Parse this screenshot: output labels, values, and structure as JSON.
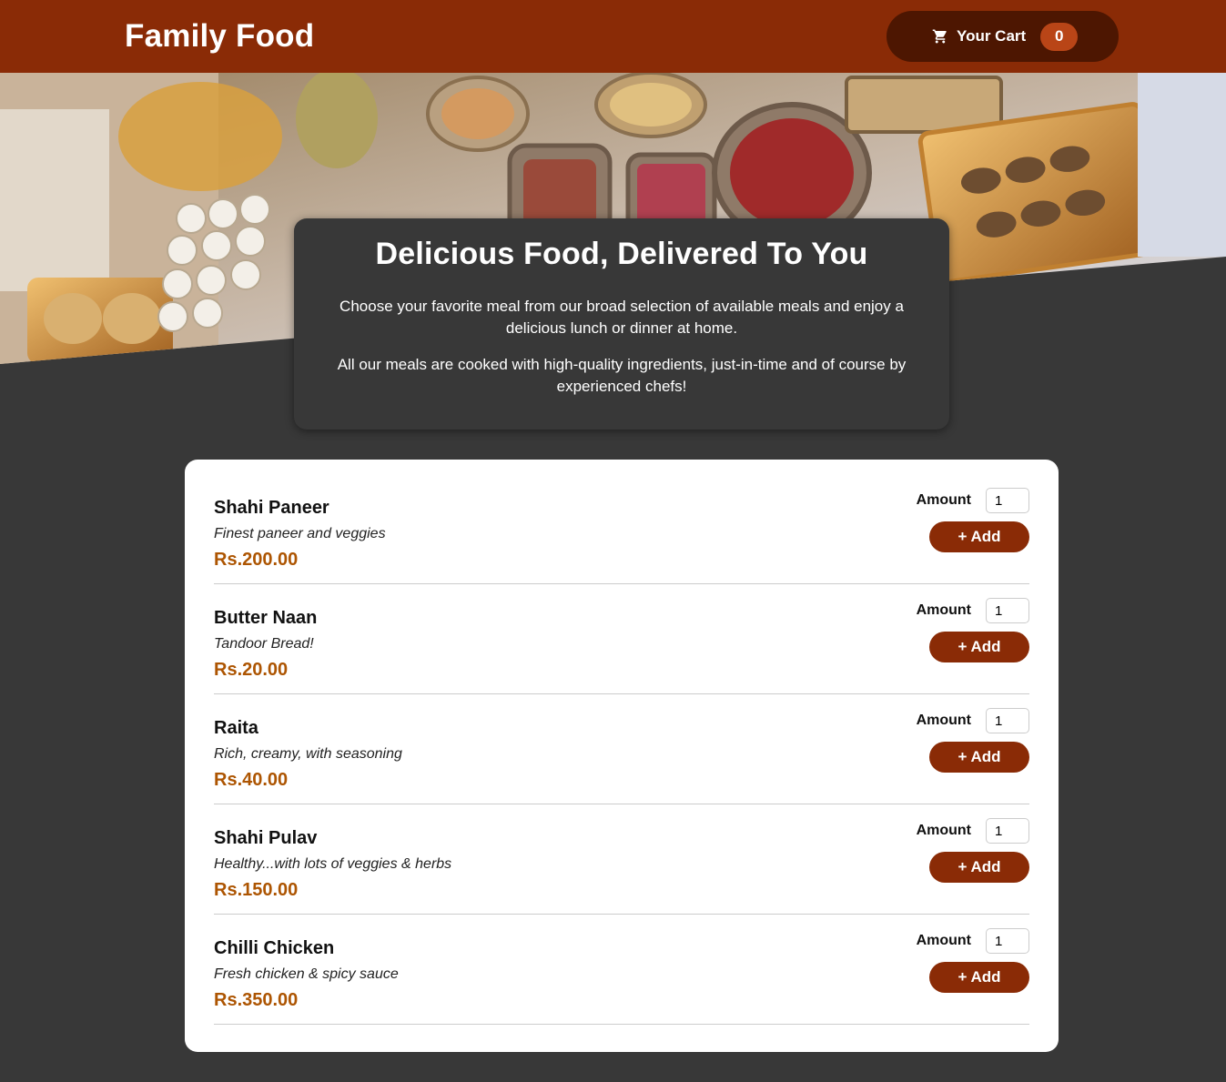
{
  "header": {
    "brand": "Family Food",
    "cart_label": "Your Cart",
    "cart_count": "0"
  },
  "intro": {
    "title": "Delicious Food, Delivered To You",
    "paragraph_1": "Choose your favorite meal from our broad selection of available meals and enjoy a delicious lunch or dinner at home.",
    "paragraph_2": "All our meals are cooked with high-quality ingredients, just-in-time and of course by experienced chefs!"
  },
  "meals": [
    {
      "name": "Shahi Paneer",
      "description": "Finest paneer and veggies",
      "price": "Rs.200.00",
      "amount_label": "Amount",
      "amount_value": "1",
      "add_label": "+ Add"
    },
    {
      "name": "Butter Naan",
      "description": "Tandoor Bread!",
      "price": "Rs.20.00",
      "amount_label": "Amount",
      "amount_value": "1",
      "add_label": "+ Add"
    },
    {
      "name": "Raita",
      "description": "Rich, creamy, with seasoning",
      "price": "Rs.40.00",
      "amount_label": "Amount",
      "amount_value": "1",
      "add_label": "+ Add"
    },
    {
      "name": "Shahi Pulav",
      "description": "Healthy...with lots of veggies & herbs",
      "price": "Rs.150.00",
      "amount_label": "Amount",
      "amount_value": "1",
      "add_label": "+ Add"
    },
    {
      "name": "Chilli Chicken",
      "description": "Fresh chicken & spicy sauce",
      "price": "Rs.350.00",
      "amount_label": "Amount",
      "amount_value": "1",
      "add_label": "+ Add"
    }
  ],
  "colors": {
    "header": "#8a2b06",
    "cart_button": "#4d1601",
    "badge": "#b94517",
    "price": "#ad5502",
    "background": "#383838"
  },
  "icons": {
    "cart": "cart-icon",
    "hero": "food-table-image"
  }
}
